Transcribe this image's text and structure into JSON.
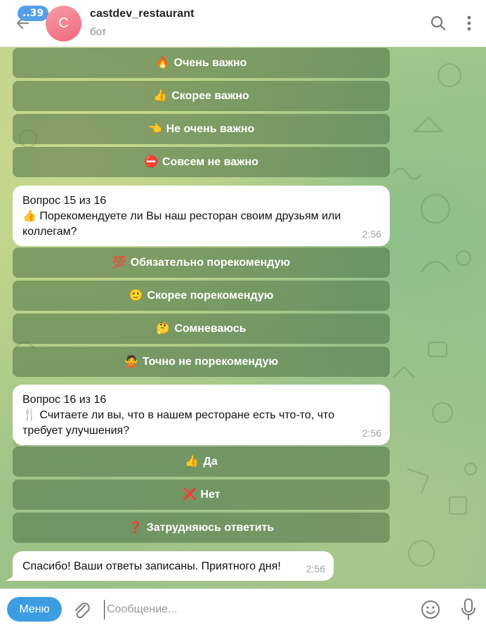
{
  "header": {
    "back_icon": "arrow-left-icon",
    "unread_badge": "..39",
    "avatar_letter": "C",
    "title": "castdev_restaurant",
    "subtitle": "бот",
    "search_icon": "search-icon",
    "more_icon": "more-vertical-icon"
  },
  "keyboard_q14": [
    {
      "emoji": "🔥",
      "label": "Очень важно"
    },
    {
      "emoji": "👍",
      "label": "Скорее важно"
    },
    {
      "emoji": "👈",
      "label": "Не очень важно"
    },
    {
      "emoji": "⛔",
      "label": "Совсем не важно"
    }
  ],
  "message_q15": {
    "line1": "Вопрос 15 из 16",
    "emoji": "👍",
    "line2": "Порекомендуете ли Вы наш ресторан своим друзьям или",
    "line3": "коллегам?",
    "time": "2:56"
  },
  "keyboard_q15": [
    {
      "emoji": "💯",
      "label": "Обязательно порекомендую"
    },
    {
      "emoji": "🙂",
      "label": "Скорее порекомендую"
    },
    {
      "emoji": "🤔",
      "label": "Сомневаюсь"
    },
    {
      "emoji": "🙅",
      "label": "Точно не порекомендую"
    }
  ],
  "message_q16": {
    "line1": "Вопрос 16 из 16",
    "emoji": "🍴",
    "line2": "Считаете ли вы, что в нашем ресторане есть что-то, что",
    "line3": "требует улучшения?",
    "time": "2:56"
  },
  "keyboard_q16": [
    {
      "emoji": "👍",
      "label": "Да"
    },
    {
      "emoji": "❌",
      "label": "Нет"
    },
    {
      "emoji": "❓",
      "label": "Затрудняюсь ответить"
    }
  ],
  "message_final": {
    "text": "Спасибо! Ваши ответы записаны. Приятного дня!",
    "time": "2:56"
  },
  "composer": {
    "menu_label": "Меню",
    "placeholder": "Сообщение...",
    "attach_icon": "paperclip-icon",
    "emoji_icon": "smile-icon",
    "mic_icon": "microphone-icon"
  },
  "colors": {
    "accent": "#3d9de2",
    "badge": "#54a0e6",
    "button_bg": "rgba(76,112,70,0.55)"
  }
}
